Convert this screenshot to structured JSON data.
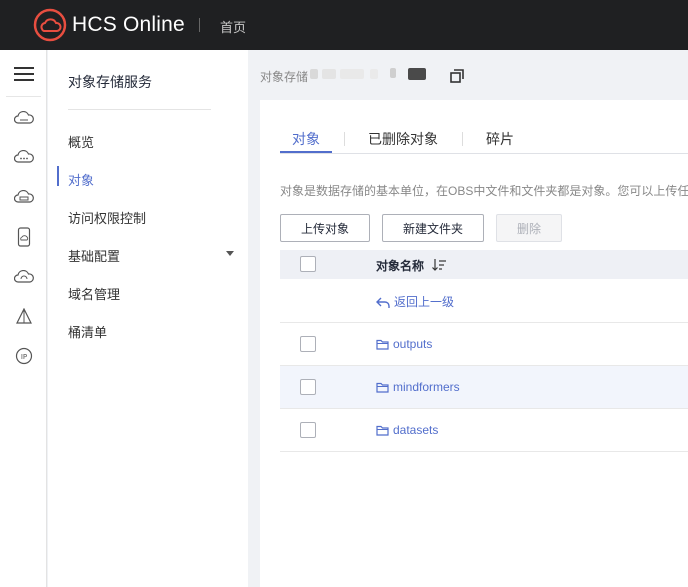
{
  "topbar": {
    "brand": "HCS Online",
    "home_label": "首页",
    "colors": {
      "background": "#1f2022",
      "logo": "#e84e40"
    }
  },
  "rail": {
    "icons": [
      "menu-icon",
      "cloud-drive-icon",
      "cloud-more-icon",
      "cloud-storage-icon",
      "mobile-icon",
      "cloud-refresh-icon",
      "pyramid-icon",
      "ip-icon"
    ]
  },
  "service_nav": {
    "title": "对象存储服务",
    "items": [
      {
        "label": "概览"
      },
      {
        "label": "对象"
      },
      {
        "label": "访问权限控制"
      },
      {
        "label": "基础配置"
      },
      {
        "label": "域名管理"
      },
      {
        "label": "桶清单"
      }
    ],
    "active_index": 1
  },
  "main": {
    "breadcrumb": "对象存储",
    "tabs": [
      {
        "label": "对象"
      },
      {
        "label": "已删除对象"
      },
      {
        "label": "碎片"
      }
    ],
    "description": "对象是数据存储的基本单位，在OBS中文件和文件夹都是对象。您可以上传任",
    "buttons": {
      "upload": "上传对象",
      "new_folder": "新建文件夹",
      "delete": "删除"
    },
    "table": {
      "header": "对象名称",
      "back_link": "返回上一级",
      "rows": [
        {
          "name": "outputs"
        },
        {
          "name": "mindformers"
        },
        {
          "name": "datasets"
        }
      ]
    },
    "accent_color": "#526ecc"
  }
}
